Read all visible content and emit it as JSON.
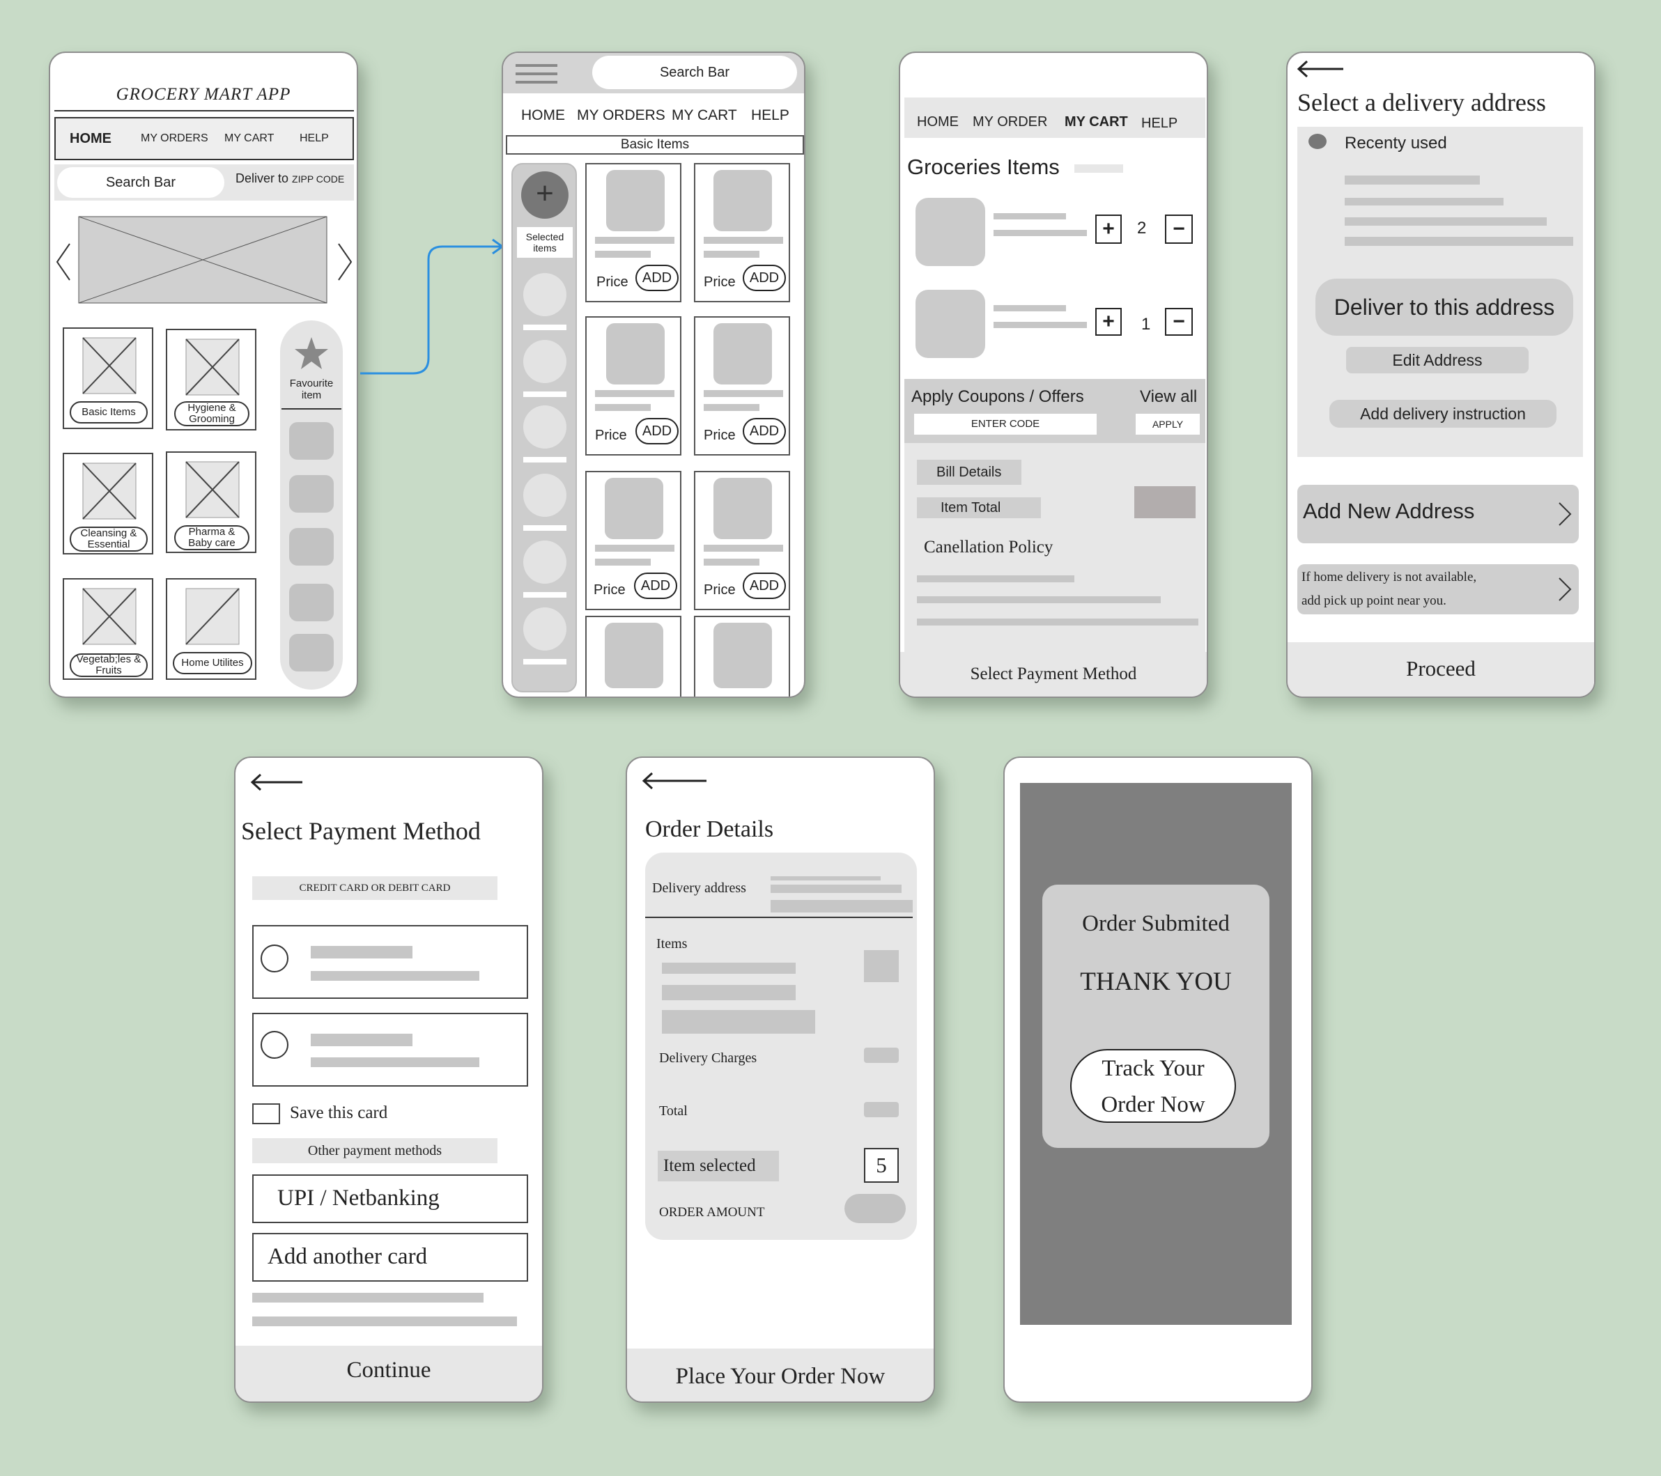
{
  "s1": {
    "title": "GROCERY MART APP",
    "nav": [
      "HOME",
      "MY ORDERS",
      "MY CART",
      "HELP"
    ],
    "search": "Search Bar",
    "deliver_to": "Deliver to",
    "zip": "ZIPP CODE",
    "categories": [
      "Basic Items",
      "Hygiene & Grooming",
      "Cleansing & Essential",
      "Pharma & Baby care",
      "Vegetab;les & Fruits",
      "Home Utilites"
    ],
    "favourite": "Favourite item"
  },
  "s2": {
    "search": "Search Bar",
    "nav": [
      "HOME",
      "MY ORDERS",
      "MY CART",
      "HELP"
    ],
    "section": "Basic Items",
    "selected": "Selected items",
    "price": "Price",
    "add": "ADD"
  },
  "s3": {
    "nav": [
      "HOME",
      "MY ORDER",
      "MY CART",
      "HELP"
    ],
    "title": "Groceries Items",
    "qty": [
      "2",
      "1"
    ],
    "plus": "+",
    "minus": "−",
    "coupons": "Apply Coupons / Offers",
    "view_all": "View all",
    "code_placeholder": "ENTER  CODE",
    "apply": "APPLY",
    "bill": "Bill Details",
    "item_total": "Item Total",
    "policy": "Canellation Policy",
    "footer": "Select Payment Method"
  },
  "s4": {
    "title": "Select  a delivery address",
    "recent": "Recenty used",
    "deliver_btn": "Deliver to this address",
    "edit": "Edit Address",
    "instruction": "Add delivery instruction",
    "new_addr": "Add New Address",
    "pickup1": "If  home delivery is not available,",
    "pickup2": "add pick up point near you.",
    "footer": "Proceed"
  },
  "s5": {
    "title": "Select  Payment Method",
    "card_header": "CREDIT CARD OR DEBIT CARD",
    "save": "Save this card",
    "other": "Other payment methods",
    "upi": "UPI / Netbanking",
    "another": "Add another card",
    "footer": "Continue"
  },
  "s6": {
    "title": "Order Details",
    "delivery_address": "Delivery address",
    "items": "Items",
    "delivery_charges": "Delivery Charges",
    "total": "Total",
    "item_selected": "Item selected",
    "count": "5",
    "order_amount": "ORDER AMOUNT",
    "footer": "Place Your Order Now"
  },
  "s7": {
    "submitted": "Order Submited",
    "thanks": "THANK YOU",
    "track1": "Track  Your",
    "track2": "Order Now"
  }
}
